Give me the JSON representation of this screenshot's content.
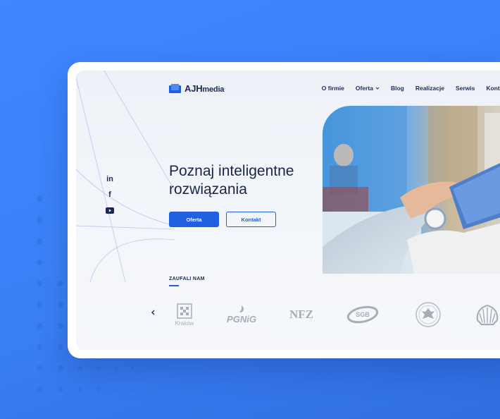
{
  "brand": {
    "name_bold": "AJH",
    "name_rest": "media"
  },
  "nav": {
    "items": [
      {
        "label": "O firmie"
      },
      {
        "label": "Oferta",
        "has_dropdown": true
      },
      {
        "label": "Blog"
      },
      {
        "label": "Realizacje"
      },
      {
        "label": "Serwis"
      },
      {
        "label": "Kontakt"
      }
    ]
  },
  "social": {
    "icons": [
      "linkedin-icon",
      "facebook-icon",
      "youtube-icon"
    ],
    "linkedin_text": "in",
    "facebook_text": "f"
  },
  "hero": {
    "title_line1": "Poznaj inteligentne",
    "title_line2": "rozwiązania",
    "primary_button": "Oferta",
    "secondary_button": "Kontakt"
  },
  "trusted": {
    "label": "ZAUFALI NAM",
    "logos": [
      {
        "name": "krakow-logo",
        "caption": "Kraków"
      },
      {
        "name": "pgnig-logo",
        "text": "PGNiG"
      },
      {
        "name": "nfz-logo",
        "text": "NFZ"
      },
      {
        "name": "sgb-logo",
        "text": "SGB"
      },
      {
        "name": "emblem-logo"
      },
      {
        "name": "shell-logo"
      }
    ]
  },
  "colors": {
    "background": "#3f86ff",
    "accent": "#1f5fe0",
    "text": "#1a2548"
  }
}
